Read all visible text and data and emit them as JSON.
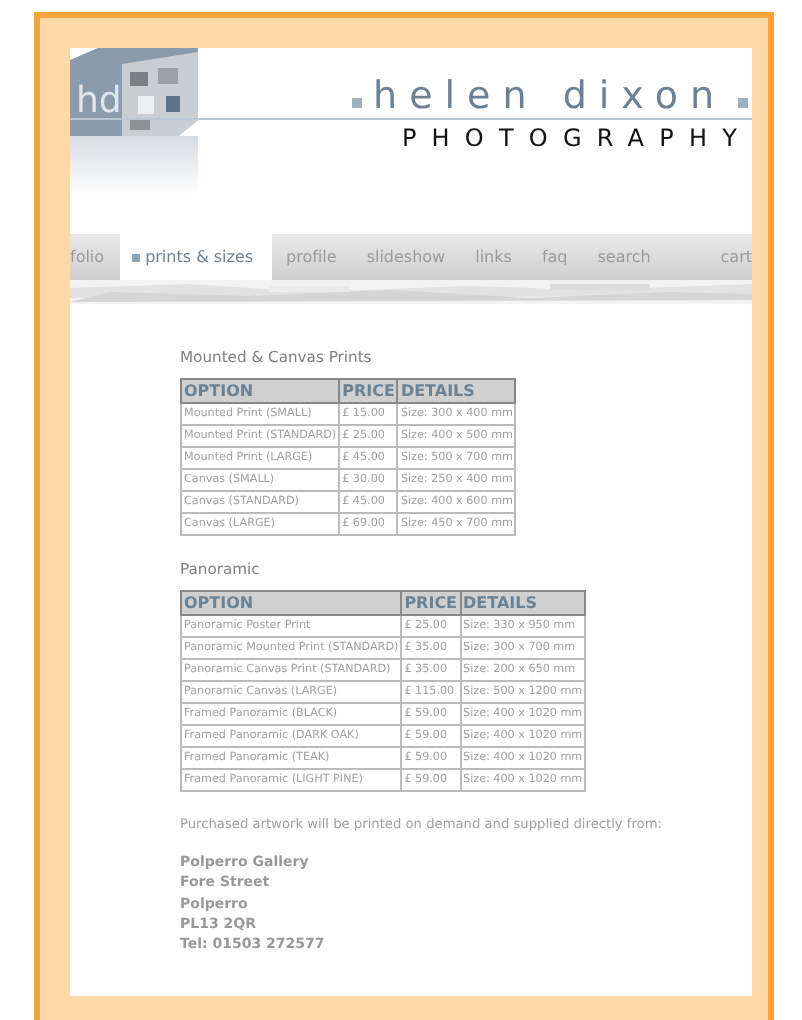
{
  "header": {
    "logo_text": "hd",
    "title": "helen dixon",
    "subtitle": "PHOTOGRAPHY"
  },
  "nav": [
    {
      "label": "folio",
      "selected": false
    },
    {
      "label": "prints & sizes",
      "selected": true
    },
    {
      "label": "profile",
      "selected": false
    },
    {
      "label": "slideshow",
      "selected": false
    },
    {
      "label": "links",
      "selected": false
    },
    {
      "label": "faq",
      "selected": false
    },
    {
      "label": "search",
      "selected": false
    },
    {
      "label": "cart",
      "selected": false
    }
  ],
  "sections": [
    {
      "heading": "Mounted & Canvas Prints",
      "columns": [
        "OPTION",
        "PRICE",
        "DETAILS"
      ],
      "rows": [
        [
          "Mounted Print (SMALL)",
          "£ 15.00",
          "Size: 300 x 400 mm"
        ],
        [
          "Mounted Print (STANDARD)",
          "£ 25.00",
          "Size: 400 x 500 mm"
        ],
        [
          "Mounted Print (LARGE)",
          "£ 45.00",
          "Size: 500 x 700 mm"
        ],
        [
          "Canvas (SMALL)",
          "£ 30.00",
          "Size: 250 x 400 mm"
        ],
        [
          "Canvas (STANDARD)",
          "£ 45.00",
          "Size: 400 x 600 mm"
        ],
        [
          "Canvas (LARGE)",
          "£ 69.00",
          "Size: 450 x 700 mm"
        ]
      ]
    },
    {
      "heading": "Panoramic",
      "columns": [
        "OPTION",
        "PRICE",
        "DETAILS"
      ],
      "rows": [
        [
          "Panoramic Poster Print",
          "£ 25.00",
          "Size: 330 x 950 mm"
        ],
        [
          "Panoramic Mounted Print (STANDARD)",
          "£ 35.00",
          "Size: 300 x 700 mm"
        ],
        [
          "Panoramic Canvas Print (STANDARD)",
          "£ 35.00",
          "Size: 200 x 650 mm"
        ],
        [
          "Panoramic Canvas (LARGE)",
          "£ 115.00",
          "Size: 500 x 1200 mm"
        ],
        [
          "Framed Panoramic (BLACK)",
          "£ 59.00",
          "Size: 400 x 1020 mm"
        ],
        [
          "Framed Panoramic (DARK OAK)",
          "£ 59.00",
          "Size: 400 x 1020 mm"
        ],
        [
          "Framed Panoramic (TEAK)",
          "£ 59.00",
          "Size: 400 x 1020 mm"
        ],
        [
          "Framed Panoramic (LIGHT PINE)",
          "£ 59.00",
          "Size: 400 x 1020 mm"
        ]
      ]
    }
  ],
  "note": "Purchased artwork will be printed on demand and supplied directly from:",
  "address": [
    "Polperro Gallery",
    "Fore Street",
    "Polperro",
    "PL13 2QR",
    "Tel: 01503 272577"
  ]
}
